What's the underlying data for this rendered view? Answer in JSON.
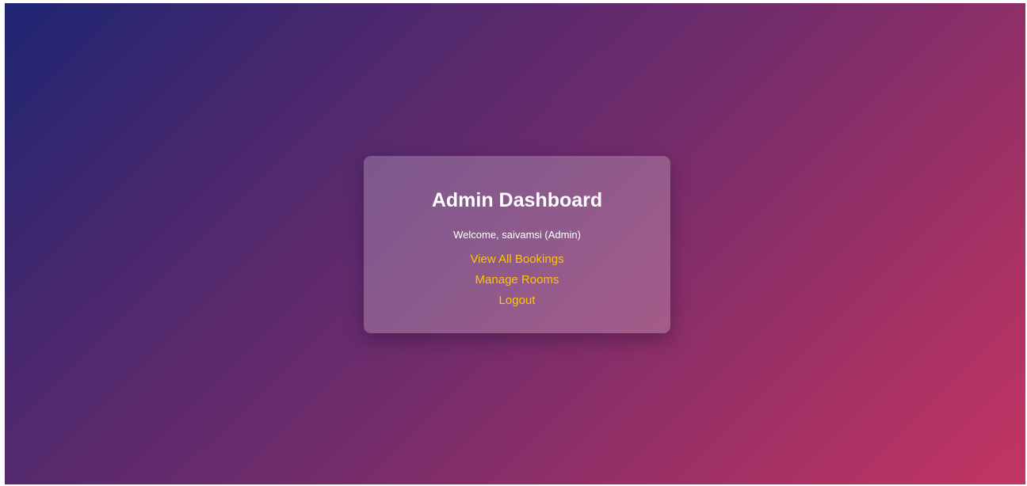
{
  "dashboard": {
    "title": "Admin Dashboard",
    "welcome_prefix": "Welcome, ",
    "username": "saivamsi",
    "role": " (Admin)"
  },
  "nav": {
    "links": [
      {
        "label": "View All Bookings"
      },
      {
        "label": "Manage Rooms"
      },
      {
        "label": "Logout"
      }
    ]
  },
  "colors": {
    "gradient_start": "#1e2672",
    "gradient_end": "#c33563",
    "card_background": "rgba(255,255,255,0.22)",
    "link": "#ffc400",
    "text": "#ffffff"
  }
}
